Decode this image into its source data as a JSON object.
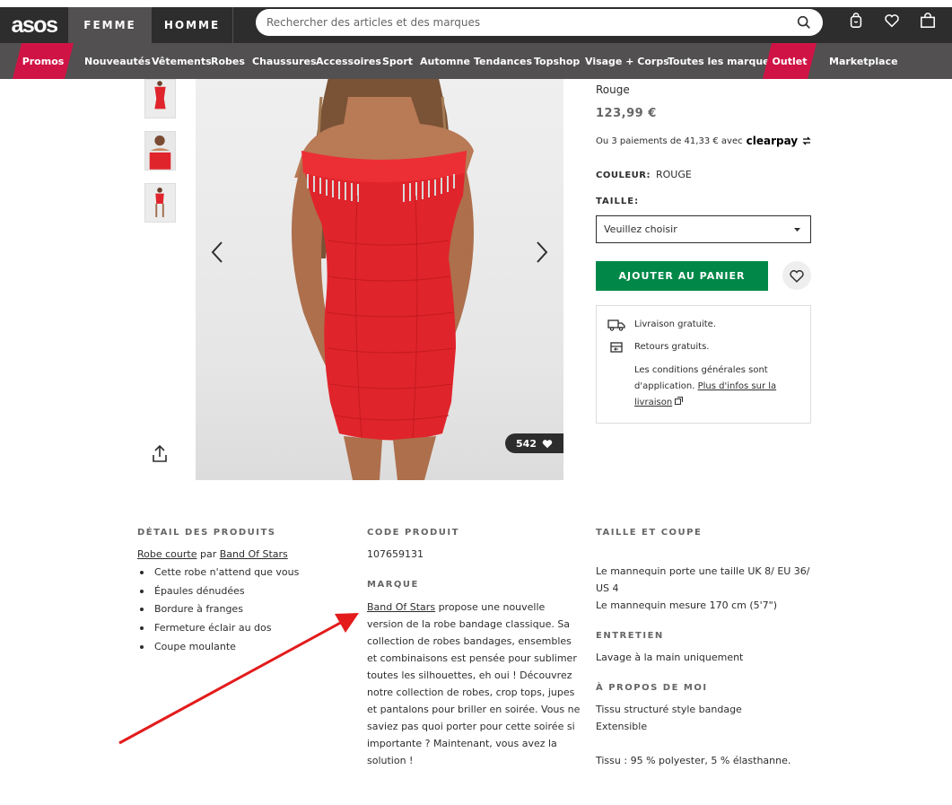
{
  "header": {
    "logo": "asos",
    "tabs": [
      "FEMME",
      "HOMME"
    ],
    "search_placeholder": "Rechercher des articles et des marques"
  },
  "nav": {
    "items": [
      "Promos",
      "Nouveautés",
      "Vêtements",
      "Robes",
      "Chaussures",
      "Accessoires",
      "Sport",
      "Automne",
      "Tendances",
      "Topshop",
      "Visage + Corps",
      "Toutes les marques",
      "Outlet",
      "Marketplace"
    ]
  },
  "gallery": {
    "likes": "542"
  },
  "product": {
    "color_top": "Rouge",
    "price": "123,99 €",
    "installments": "Ou 3 paiements de 41,33 € avec",
    "clearpay": "clearpay",
    "color_label": "COULEUR:",
    "color_value": "ROUGE",
    "size_label": "TAILLE:",
    "size_placeholder": "Veuillez choisir",
    "add_to_cart": "AJOUTER AU PANIER"
  },
  "delivery": {
    "free_delivery": "Livraison gratuite.",
    "free_returns": "Retours gratuits.",
    "conditions": "Les conditions générales sont d'application.",
    "more_info": "Plus d'infos sur la livraison"
  },
  "details": {
    "product_details": {
      "heading": "DÉTAIL DES PRODUITS",
      "type_link": "Robe courte",
      "by": "par",
      "brand_link": "Band Of Stars",
      "bullets": [
        "Cette robe n'attend que vous",
        "Épaules dénudées",
        "Bordure à franges",
        "Fermeture éclair au dos",
        "Coupe moulante"
      ]
    },
    "product_code": {
      "heading": "CODE PRODUIT",
      "value": "107659131"
    },
    "brand": {
      "heading": "MARQUE",
      "link": "Band Of Stars",
      "text": "propose une nouvelle version de la robe bandage classique. Sa collection de robes bandages, ensembles et combinaisons est pensée pour sublimer toutes les silhouettes, eh oui ! Découvrez notre collection de robes, crop tops, jupes et pantalons pour briller en soirée. Vous ne saviez pas quoi porter pour cette soirée si importante ? Maintenant, vous avez la solution !"
    },
    "size_fit": {
      "heading": "TAILLE ET COUPE",
      "line1": "Le mannequin porte une taille UK 8/ EU 36/ US 4",
      "line2": "Le mannequin mesure 170 cm (5'7\")"
    },
    "care": {
      "heading": "ENTRETIEN",
      "value": "Lavage à la main uniquement"
    },
    "about": {
      "heading": "À PROPOS DE MOI",
      "line1": "Tissu structuré style bandage",
      "line2": "Extensible",
      "line3": "Tissu : 95 % polyester, 5 % élasthanne."
    }
  },
  "colors": {
    "dark": "#2d2d2d",
    "nav": "#525050",
    "promo": "#d01345",
    "cta": "#018849",
    "dress": "#e0242b",
    "annotation_arrow": "#e31b1b"
  }
}
